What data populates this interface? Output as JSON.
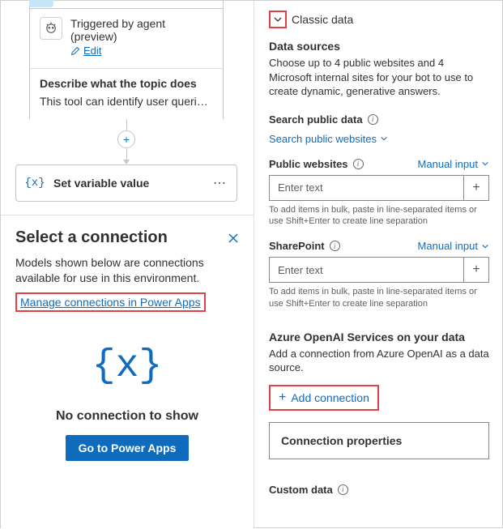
{
  "flow": {
    "trigger_title": "Triggered by agent (preview)",
    "edit_label": "Edit",
    "describe_label": "Describe what the topic does",
    "describe_text": "This tool can identify user queries that seek f...",
    "set_var_label": "Set variable value"
  },
  "select_panel": {
    "title": "Select a connection",
    "subtitle": "Models shown below are connections available for use in this environment.",
    "manage_link": "Manage connections in Power Apps",
    "empty_icon": "{x}",
    "empty_text": "No connection to show",
    "go_button": "Go to Power Apps"
  },
  "right": {
    "classic_data": "Classic data",
    "data_sources_h": "Data sources",
    "data_sources_p": "Choose up to 4 public websites and 4 Microsoft internal sites for your bot to use to create dynamic, generative answers.",
    "search_public_h": "Search public data",
    "search_public_link": "Search public websites",
    "public_websites_h": "Public websites",
    "manual_input": "Manual input",
    "enter_text": "Enter text",
    "bulk_hint": "To add items in bulk, paste in line-separated items or use Shift+Enter to create line separation",
    "sharepoint_h": "SharePoint",
    "aoai_h": "Azure OpenAI Services on your data",
    "aoai_p": "Add a connection from Azure OpenAI as a data source.",
    "add_connection": "Add connection",
    "conn_props": "Connection properties",
    "custom_data_h": "Custom data"
  }
}
